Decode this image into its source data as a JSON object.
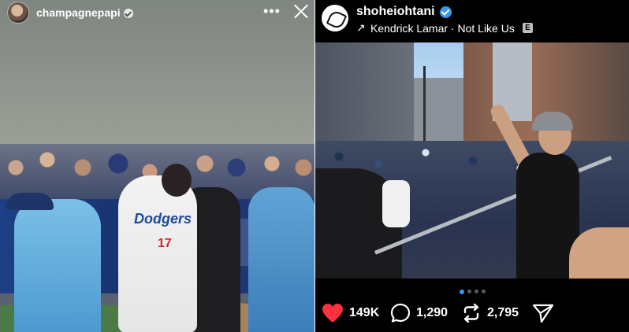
{
  "story": {
    "username": "champagnepapi",
    "icons": {
      "avatar": "profile-avatar",
      "verified": "verified-badge-icon",
      "more": "more-options-icon",
      "close": "close-icon"
    },
    "more_label": "•••",
    "photo": {
      "jersey_text": "Dodgers",
      "jersey_number": "17"
    }
  },
  "post": {
    "username": "shoheiohtani",
    "icons": {
      "avatar": "profile-avatar",
      "verified": "verified-badge-icon",
      "music": "music-arrow-icon",
      "explicit": "explicit-badge-icon"
    },
    "music": {
      "arrow": "↗",
      "track": "Kendrick Lamar · Not Like Us",
      "explicit_label": "E"
    },
    "carousel": {
      "count": 4,
      "active_index": 0
    },
    "actions": {
      "likes": "149K",
      "comments": "1,290",
      "reposts": "2,795",
      "icons": [
        "heart-icon",
        "comment-icon",
        "repost-icon",
        "share-icon"
      ],
      "like_color": "#ff3040"
    }
  }
}
